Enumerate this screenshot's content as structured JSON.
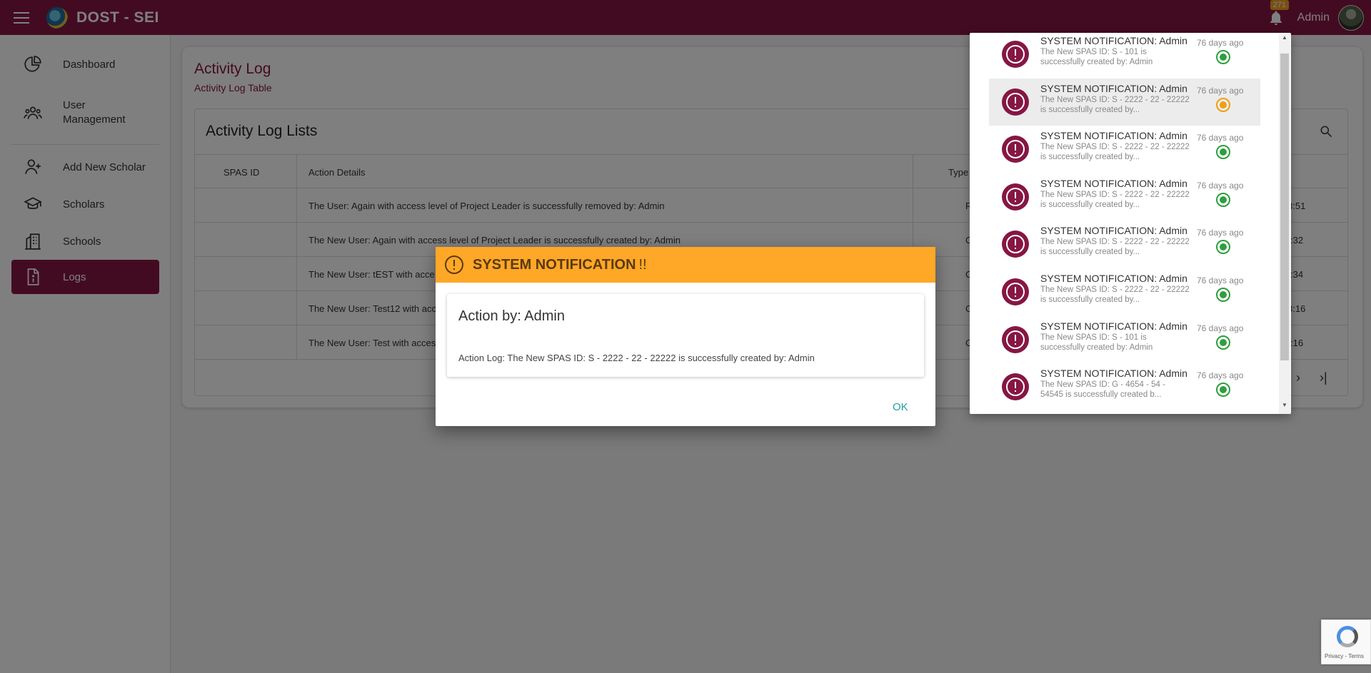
{
  "app": {
    "brand": "DOST - SEI",
    "user": "Admin",
    "notification_count": "271"
  },
  "sidebar": {
    "items": [
      {
        "label": "Dashboard",
        "icon": "dashboard-icon"
      },
      {
        "label": "User Management",
        "icon": "users-icon"
      },
      {
        "label": "Add New Scholar",
        "icon": "add-user-icon"
      },
      {
        "label": "Scholars",
        "icon": "graduation-cap-icon"
      },
      {
        "label": "Schools",
        "icon": "building-icon"
      },
      {
        "label": "Logs",
        "icon": "document-info-icon",
        "active": true
      }
    ]
  },
  "page": {
    "title": "Activity Log",
    "subtitle": "Activity Log Table",
    "table_title": "Activity Log Lists",
    "headers": {
      "spas_id": "SPAS ID",
      "action": "Action Details",
      "type": "Type o"
    },
    "rows": [
      {
        "spas_id": "",
        "action": "The User: Again with access level of Project Leader is successfully removed by: Admin",
        "type": "R",
        "time": "3:51"
      },
      {
        "spas_id": "",
        "action": "The New User: Again with access level of Project Leader is successfully created by: Admin",
        "type": "C",
        "time": ":32"
      },
      {
        "spas_id": "",
        "action": "The New User: tEST with acce",
        "type": "C",
        "time": ":34"
      },
      {
        "spas_id": "",
        "action": "The New User: Test12 with acc",
        "type": "C",
        "time": "3:16"
      },
      {
        "spas_id": "",
        "action": "The New User: Test with acces",
        "type": "C",
        "time": ":16"
      }
    ]
  },
  "dialog": {
    "title": "SYSTEM NOTIFICATION",
    "bangs": "!!",
    "actor": "Action by: Admin",
    "log": "Action Log: The New SPAS ID: S - 2222 - 22 - 22222 is successfully created by: Admin",
    "ok": "OK"
  },
  "notifications": [
    {
      "title": "SYSTEM NOTIFICATION: Admin",
      "msg": "The New SPAS ID: S - 101 is successfully created by: Admin",
      "time": "76 days ago",
      "status": "green"
    },
    {
      "title": "SYSTEM NOTIFICATION: Admin",
      "msg": "The New SPAS ID: S - 2222 - 22 - 22222 is successfully created by...",
      "time": "76 days ago",
      "status": "orange",
      "highlighted": true
    },
    {
      "title": "SYSTEM NOTIFICATION: Admin",
      "msg": "The New SPAS ID: S - 2222 - 22 - 22222 is successfully created by...",
      "time": "76 days ago",
      "status": "green"
    },
    {
      "title": "SYSTEM NOTIFICATION: Admin",
      "msg": "The New SPAS ID: S - 2222 - 22 - 22222 is successfully created by...",
      "time": "76 days ago",
      "status": "green"
    },
    {
      "title": "SYSTEM NOTIFICATION: Admin",
      "msg": "The New SPAS ID: S - 2222 - 22 - 22222 is successfully created by...",
      "time": "76 days ago",
      "status": "green"
    },
    {
      "title": "SYSTEM NOTIFICATION: Admin",
      "msg": "The New SPAS ID: S - 2222 - 22 - 22222 is successfully created by...",
      "time": "76 days ago",
      "status": "green"
    },
    {
      "title": "SYSTEM NOTIFICATION: Admin",
      "msg": "The New SPAS ID: S - 101 is successfully created by: Admin",
      "time": "76 days ago",
      "status": "green"
    },
    {
      "title": "SYSTEM NOTIFICATION: Admin",
      "msg": "The New SPAS ID: G - 4654 - 54 - 54545 is successfully created b...",
      "time": "76 days ago",
      "status": "green"
    }
  ],
  "recaptcha": {
    "text": "Privacy - Terms"
  },
  "colors": {
    "brand": "#861643",
    "dialog_header": "#ffa726",
    "status_ok": "#2e9e3e",
    "status_pending": "#f29d12",
    "link": "#21a0a0"
  }
}
